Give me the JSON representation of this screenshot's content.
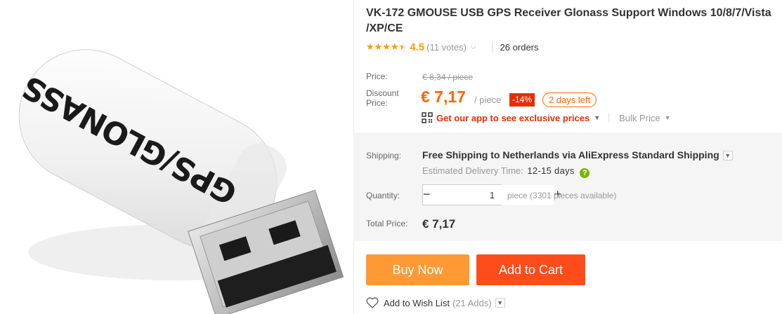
{
  "product": {
    "title": "VK-172 GMOUSE USB GPS Receiver Glonass Support Windows 10/8/7/Vista /XP/CE",
    "image_alt": "White USB GPS/Glonass receiver dongle",
    "device_print": "GPS/GLONASS"
  },
  "rating": {
    "value": "4.5",
    "value_fraction": 0.9,
    "votes": "(11 votes)",
    "orders": "26 orders"
  },
  "price": {
    "price_label": "Price:",
    "original": "€ 8,34 / piece",
    "discount_label": "Discount Price:",
    "current": "€ 7,17",
    "per_piece": "/ piece",
    "discount_badge": "-14%",
    "days_left": "2 days left",
    "app_promo": "Get our app to see exclusive prices",
    "bulk_price": "Bulk Price"
  },
  "shipping": {
    "label": "Shipping:",
    "main": "Free Shipping to Netherlands via AliExpress Standard Shipping",
    "estimated_label": "Estimated Delivery Time:",
    "estimated_days": "12-15 days",
    "help": "?"
  },
  "quantity": {
    "label": "Quantity:",
    "value": "1",
    "minus": "−",
    "plus": "+",
    "note": "piece (3301 pieces available)"
  },
  "total": {
    "label": "Total Price:",
    "value": "€ 7,17"
  },
  "actions": {
    "buy_now": "Buy Now",
    "add_to_cart": "Add to Cart",
    "wishlist_label": "Add to Wish List",
    "wishlist_count": "(21 Adds)"
  },
  "colors": {
    "accent_orange": "#ff6600",
    "buy_button": "#ff9933",
    "cart_button": "#ff4c1b",
    "discount_red": "#e62e04",
    "star": "#ff9a00"
  }
}
